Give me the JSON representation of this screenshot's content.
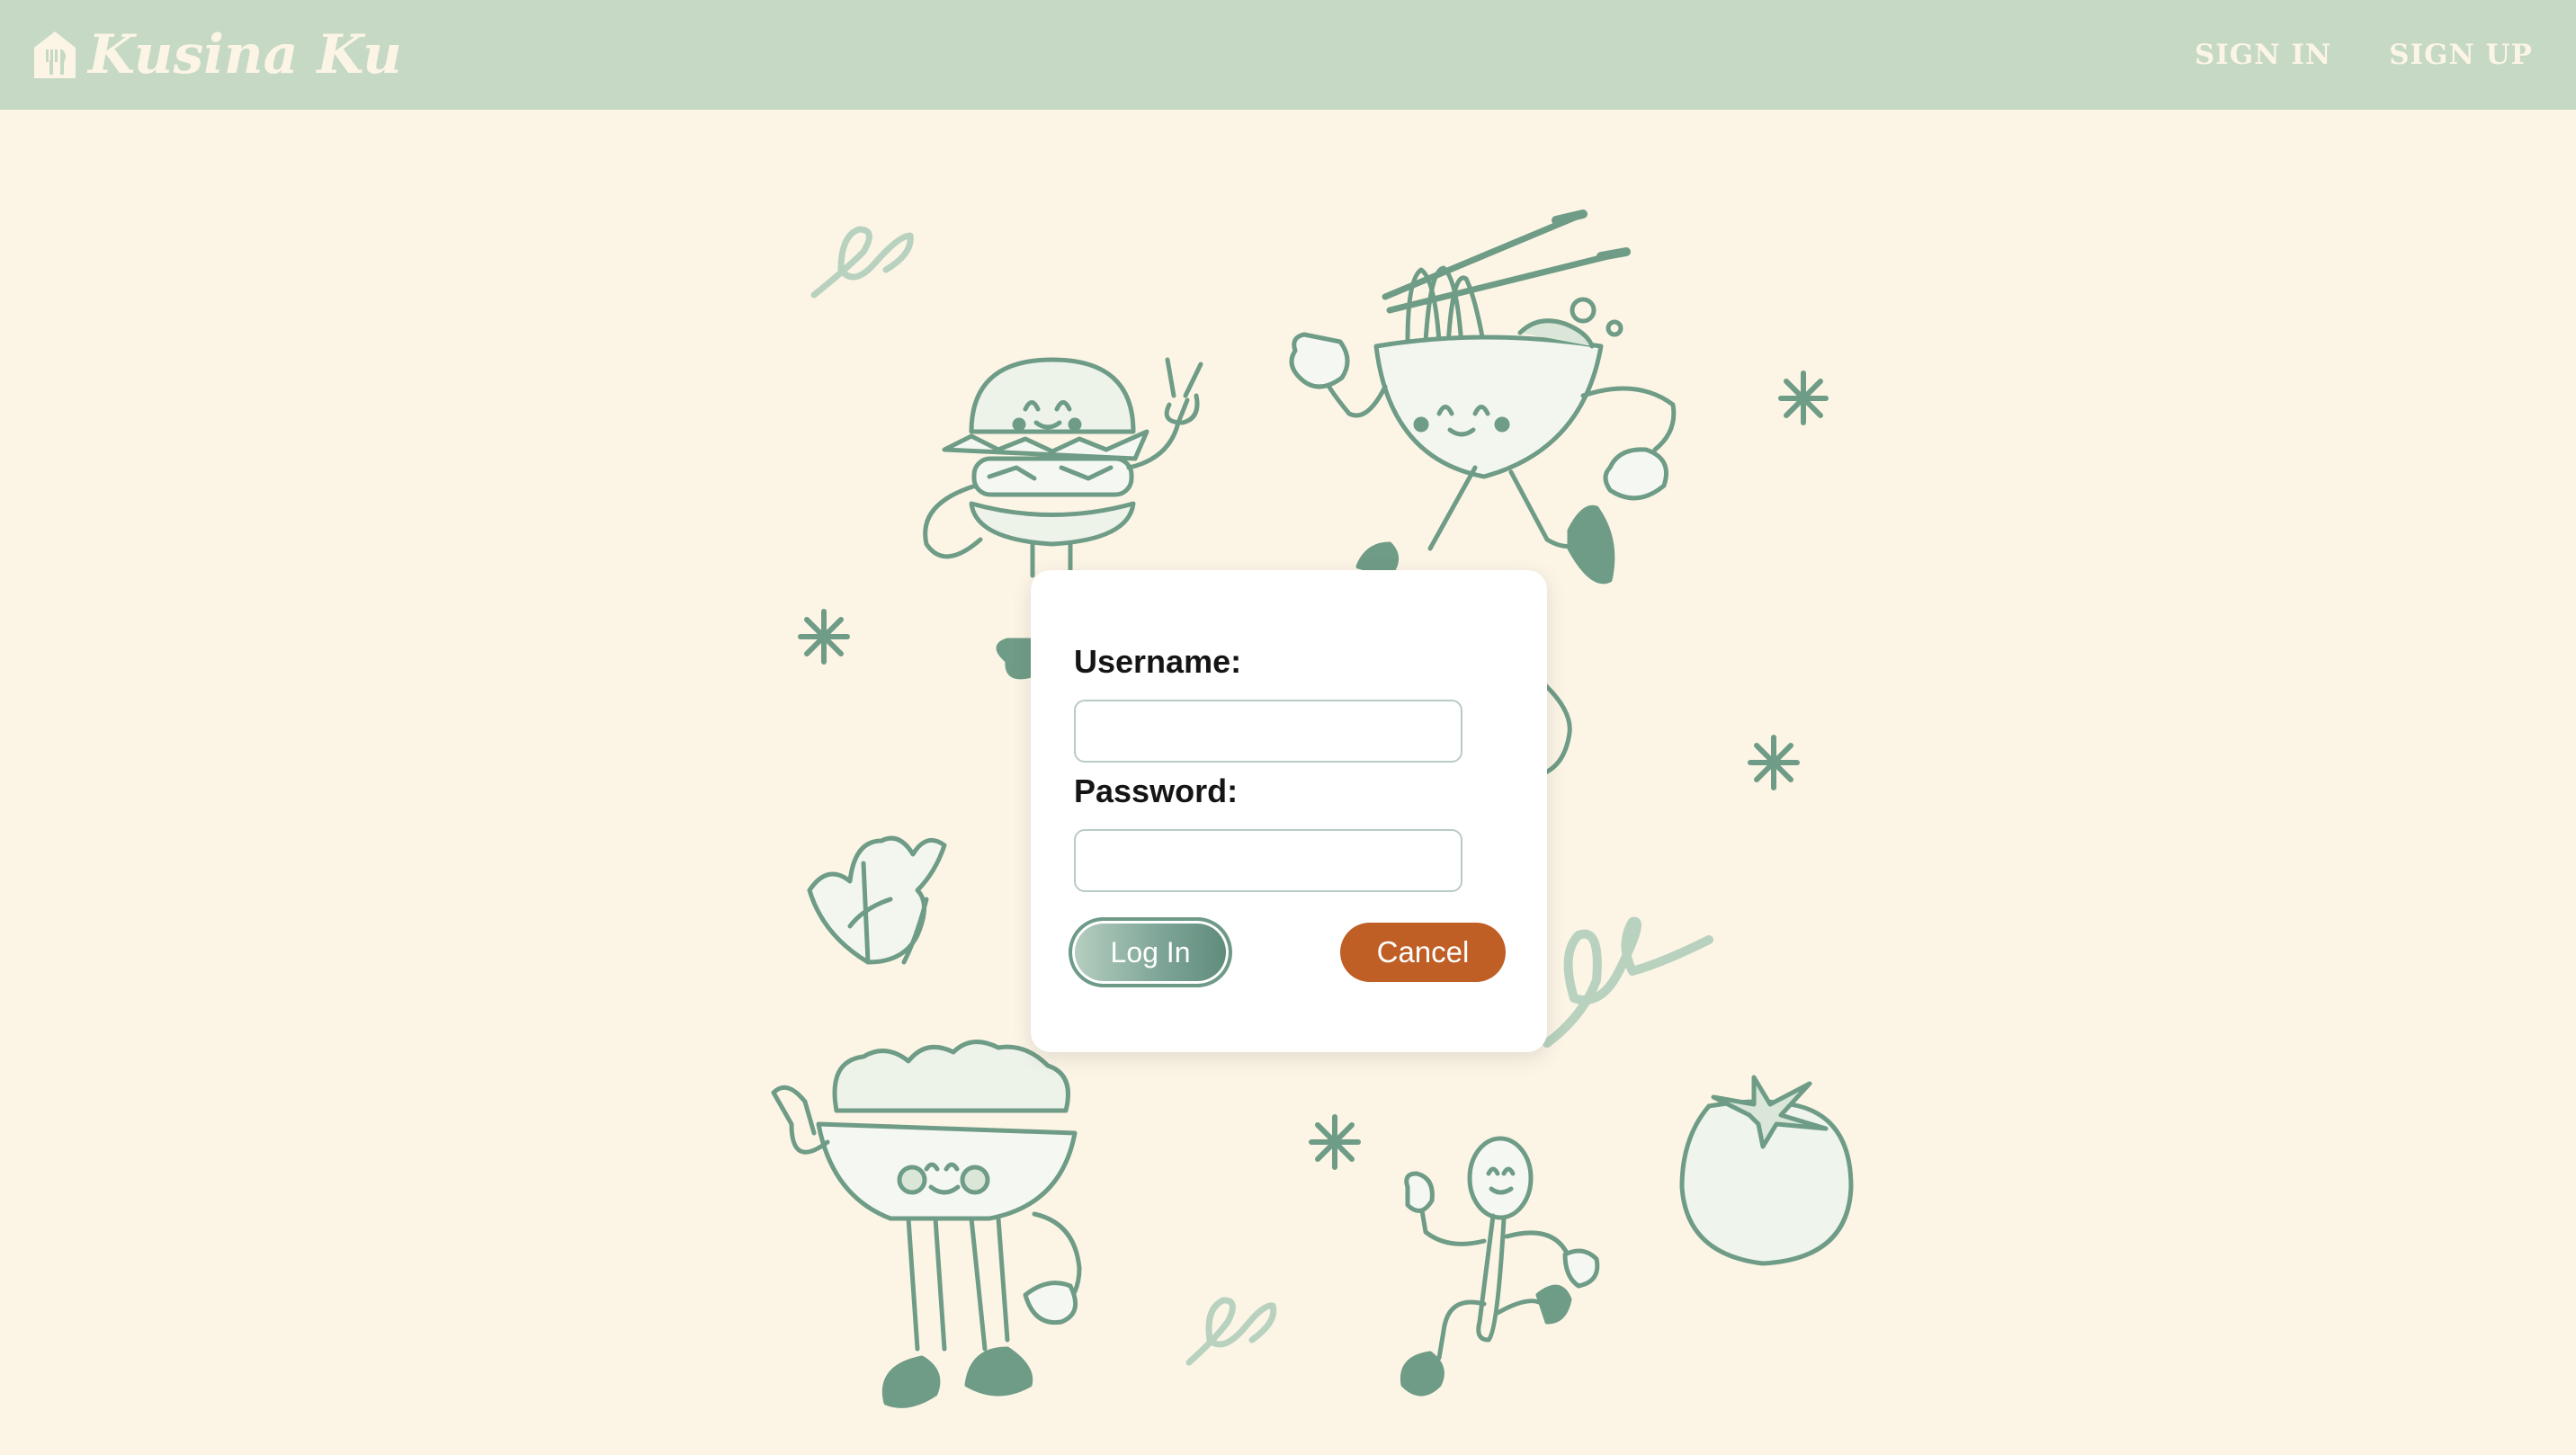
{
  "header": {
    "brand_name": "Kusina Ku",
    "brand_icon": "house-utensils-icon",
    "nav": [
      {
        "label": "SIGN IN"
      },
      {
        "label": "SIGN UP"
      }
    ]
  },
  "login_form": {
    "username_label": "Username:",
    "username_value": "",
    "password_label": "Password:",
    "password_value": "",
    "login_label": "Log In",
    "cancel_label": "Cancel"
  },
  "illustrations": [
    "burger-character-icon",
    "noodle-bowl-character-icon",
    "lettuce-icon",
    "salad-bowl-character-icon",
    "spoon-character-icon",
    "tomato-icon",
    "sparkle-icon",
    "squiggle-icon"
  ],
  "colors": {
    "header_bg": "#c5d9c5",
    "page_bg": "#fcf5e6",
    "illustration_green": "#6f9c86",
    "cancel_button": "#bf5f25"
  }
}
